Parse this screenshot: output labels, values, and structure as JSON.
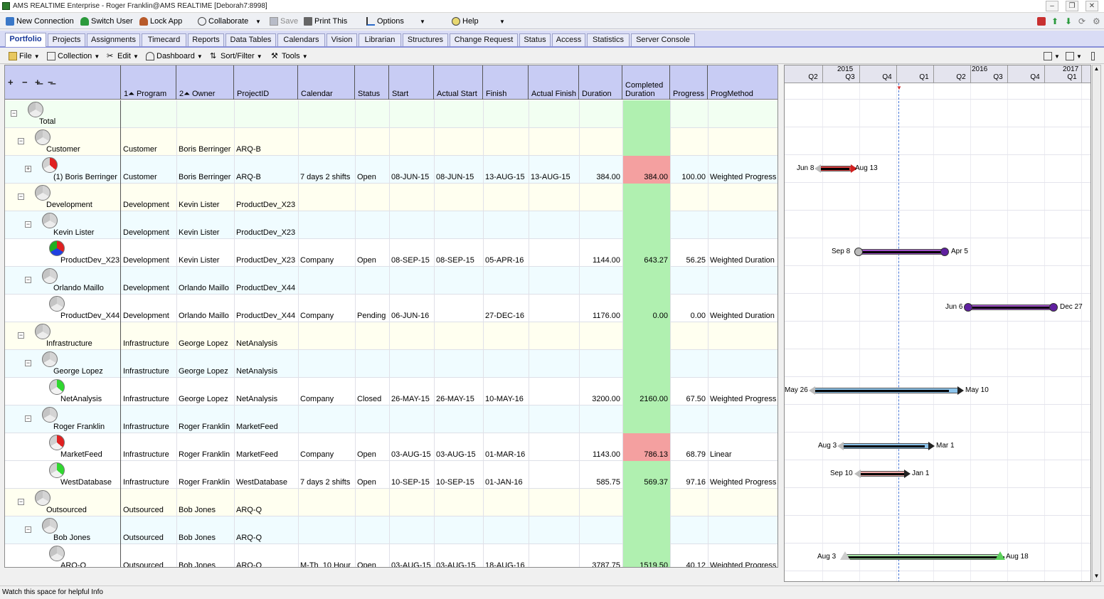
{
  "window": {
    "title": "AMS REALTIME Enterprise - Roger Franklin@AMS REALTIME [Deborah7:8998]"
  },
  "toolbar": {
    "new_connection": "New Connection",
    "switch_user": "Switch User",
    "lock_app": "Lock App",
    "collaborate": "Collaborate",
    "save": "Save",
    "print_this": "Print This",
    "options": "Options",
    "help": "Help"
  },
  "tabs": [
    "Portfolio",
    "Projects",
    "Assignments",
    "Timecard",
    "Reports",
    "Data Tables",
    "Calendars",
    "Vision",
    "Librarian",
    "Structures",
    "Change Request",
    "Status",
    "Access",
    "Statistics",
    "Server Console"
  ],
  "menu": {
    "file": "File",
    "collection": "Collection",
    "edit": "Edit",
    "dashboard": "Dashboard",
    "sort_filter": "Sort/Filter",
    "tools": "Tools"
  },
  "columns": {
    "program": "1⏶ Program",
    "owner": "2⏶ Owner",
    "projectid": "ProjectID",
    "calendar": "Calendar",
    "status": "Status",
    "start": "Start",
    "actual_start": "Actual Start",
    "finish": "Finish",
    "actual_finish": "Actual Finish",
    "duration": "Duration",
    "completed_duration": "Completed Duration",
    "progress": "Progress",
    "progmethod": "ProgMethod"
  },
  "rows": [
    {
      "name": "Total",
      "level": 0,
      "pie": "grey",
      "bg": "#f2fff2",
      "program": "",
      "owner": "",
      "projectid": "",
      "calendar": "",
      "status": "",
      "start": "",
      "actual_start": "",
      "finish": "",
      "actual_finish": "",
      "duration": "",
      "completed": "",
      "progress": "",
      "method": ""
    },
    {
      "name": "Customer",
      "level": 1,
      "pie": "grey",
      "bg": "#fffff0",
      "program": "Customer",
      "owner": "Boris Berringer",
      "projectid": "ARQ-B",
      "calendar": "",
      "status": "",
      "start": "",
      "actual_start": "",
      "finish": "",
      "actual_finish": "",
      "duration": "",
      "completed": "",
      "progress": "",
      "method": ""
    },
    {
      "name": "(1) Boris Berringer",
      "level": 2,
      "pie": "red",
      "bg": "#f0fcff",
      "program": "Customer",
      "owner": "Boris Berringer",
      "projectid": "ARQ-B",
      "calendar": "7 days 2 shifts",
      "status": "Open",
      "start": "08-JUN-15",
      "actual_start": "08-JUN-15",
      "finish": "13-AUG-15",
      "actual_finish": "13-AUG-15",
      "duration": "384.00",
      "completed": "384.00",
      "completed_red": true,
      "progress": "100.00",
      "method": "Weighted Progress"
    },
    {
      "name": "Development",
      "level": 1,
      "pie": "grey",
      "bg": "#fffff0",
      "program": "Development",
      "owner": "Kevin Lister",
      "projectid": "ProductDev_X23",
      "calendar": "",
      "status": "",
      "start": "",
      "actual_start": "",
      "finish": "",
      "actual_finish": "",
      "duration": "",
      "completed": "",
      "progress": "",
      "method": ""
    },
    {
      "name": "Kevin Lister",
      "level": 2,
      "pie": "grey",
      "bg": "#f0fcff",
      "program": "Development",
      "owner": "Kevin Lister",
      "projectid": "ProductDev_X23",
      "calendar": "",
      "status": "",
      "start": "",
      "actual_start": "",
      "finish": "",
      "actual_finish": "",
      "duration": "",
      "completed": "",
      "progress": "",
      "method": ""
    },
    {
      "name": "ProductDev_X23",
      "level": 3,
      "pie": "rgb",
      "bg": "#ffffff",
      "program": "Development",
      "owner": "Kevin Lister",
      "projectid": "ProductDev_X23",
      "calendar": "Company",
      "status": "Open",
      "start": "08-SEP-15",
      "actual_start": "08-SEP-15",
      "finish": "05-APR-16",
      "actual_finish": "",
      "duration": "1144.00",
      "completed": "643.27",
      "progress": "56.25",
      "method": "Weighted Duration"
    },
    {
      "name": "Orlando Maillo",
      "level": 2,
      "pie": "grey",
      "bg": "#f0fcff",
      "program": "Development",
      "owner": "Orlando Maillo",
      "projectid": "ProductDev_X44",
      "calendar": "",
      "status": "",
      "start": "",
      "actual_start": "",
      "finish": "",
      "actual_finish": "",
      "duration": "",
      "completed": "",
      "progress": "",
      "method": ""
    },
    {
      "name": "ProductDev_X44",
      "level": 3,
      "pie": "grey",
      "bg": "#ffffff",
      "program": "Development",
      "owner": "Orlando Maillo",
      "projectid": "ProductDev_X44",
      "calendar": "Company",
      "status": "Pending",
      "start": "06-JUN-16",
      "actual_start": "",
      "finish": "27-DEC-16",
      "actual_finish": "",
      "duration": "1176.00",
      "completed": "0.00",
      "progress": "0.00",
      "method": "Weighted Duration"
    },
    {
      "name": "Infrastructure",
      "level": 1,
      "pie": "grey",
      "bg": "#fffff0",
      "program": "Infrastructure",
      "owner": "George Lopez",
      "projectid": "NetAnalysis",
      "calendar": "",
      "status": "",
      "start": "",
      "actual_start": "",
      "finish": "",
      "actual_finish": "",
      "duration": "",
      "completed": "",
      "progress": "",
      "method": ""
    },
    {
      "name": "George Lopez",
      "level": 2,
      "pie": "grey",
      "bg": "#f0fcff",
      "program": "Infrastructure",
      "owner": "George Lopez",
      "projectid": "NetAnalysis",
      "calendar": "",
      "status": "",
      "start": "",
      "actual_start": "",
      "finish": "",
      "actual_finish": "",
      "duration": "",
      "completed": "",
      "progress": "",
      "method": ""
    },
    {
      "name": "NetAnalysis",
      "level": 3,
      "pie": "green",
      "bg": "#ffffff",
      "program": "Infrastructure",
      "owner": "George Lopez",
      "projectid": "NetAnalysis",
      "calendar": "Company",
      "status": "Closed",
      "start": "26-MAY-15",
      "actual_start": "26-MAY-15",
      "finish": "10-MAY-16",
      "actual_finish": "",
      "duration": "3200.00",
      "completed": "2160.00",
      "progress": "67.50",
      "method": "Weighted Progress"
    },
    {
      "name": "Roger Franklin",
      "level": 2,
      "pie": "grey",
      "bg": "#f0fcff",
      "program": "Infrastructure",
      "owner": "Roger Franklin",
      "projectid": "MarketFeed",
      "calendar": "",
      "status": "",
      "start": "",
      "actual_start": "",
      "finish": "",
      "actual_finish": "",
      "duration": "",
      "completed": "",
      "progress": "",
      "method": ""
    },
    {
      "name": "MarketFeed",
      "level": 3,
      "pie": "red",
      "bg": "#ffffff",
      "program": "Infrastructure",
      "owner": "Roger Franklin",
      "projectid": "MarketFeed",
      "calendar": "Company",
      "status": "Open",
      "start": "03-AUG-15",
      "actual_start": "03-AUG-15",
      "finish": "01-MAR-16",
      "actual_finish": "",
      "duration": "1143.00",
      "completed": "786.13",
      "completed_red": true,
      "progress": "68.79",
      "method": "Linear"
    },
    {
      "name": "WestDatabase",
      "level": 3,
      "pie": "green",
      "bg": "#ffffff",
      "program": "Infrastructure",
      "owner": "Roger Franklin",
      "projectid": "WestDatabase",
      "calendar": "7 days 2 shifts",
      "status": "Open",
      "start": "10-SEP-15",
      "actual_start": "10-SEP-15",
      "finish": "01-JAN-16",
      "actual_finish": "",
      "duration": "585.75",
      "completed": "569.37",
      "progress": "97.16",
      "method": "Weighted Progress"
    },
    {
      "name": "Outsourced",
      "level": 1,
      "pie": "grey",
      "bg": "#fffff0",
      "program": "Outsourced",
      "owner": "Bob Jones",
      "projectid": "ARQ-Q",
      "calendar": "",
      "status": "",
      "start": "",
      "actual_start": "",
      "finish": "",
      "actual_finish": "",
      "duration": "",
      "completed": "",
      "progress": "",
      "method": ""
    },
    {
      "name": "Bob Jones",
      "level": 2,
      "pie": "grey",
      "bg": "#f0fcff",
      "program": "Outsourced",
      "owner": "Bob Jones",
      "projectid": "ARQ-Q",
      "calendar": "",
      "status": "",
      "start": "",
      "actual_start": "",
      "finish": "",
      "actual_finish": "",
      "duration": "",
      "completed": "",
      "progress": "",
      "method": ""
    },
    {
      "name": "ARQ-Q",
      "level": 3,
      "pie": "grey",
      "bg": "#ffffff",
      "program": "Outsourced",
      "owner": "Bob Jones",
      "projectid": "ARQ-Q",
      "calendar": "M-Th_10 Hour",
      "status": "Open",
      "start": "03-AUG-15",
      "actual_start": "03-AUG-15",
      "finish": "18-AUG-16",
      "actual_finish": "",
      "duration": "3787.75",
      "completed": "1519.50",
      "progress": "40.12",
      "method": "Weighted Progress"
    }
  ],
  "gantt": {
    "years": [
      "2015",
      "2016",
      "2017"
    ],
    "quarters": [
      "Q2",
      "Q3",
      "Q4",
      "Q1",
      "Q2",
      "Q3",
      "Q4",
      "Q1"
    ],
    "bars": [
      {
        "row": 2,
        "start_label": "Jun 8",
        "end_label": "Aug 13",
        "color": "#d84040"
      },
      {
        "row": 5,
        "start_label": "Sep 8",
        "end_label": "Apr 5",
        "color": "#a050c8"
      },
      {
        "row": 7,
        "start_label": "Jun 6",
        "end_label": "Dec 27",
        "color": "#a050c8"
      },
      {
        "row": 10,
        "start_label": "May 26",
        "end_label": "May 10",
        "color": "#8cc4ec"
      },
      {
        "row": 12,
        "start_label": "Aug 3",
        "end_label": "Mar 1",
        "color": "#8cc4ec"
      },
      {
        "row": 13,
        "start_label": "Sep 10",
        "end_label": "Jan 1",
        "color": "#f0a8a8"
      },
      {
        "row": 16,
        "start_label": "Aug 3",
        "end_label": "Aug 18",
        "color": "#a8e8a8"
      }
    ]
  },
  "colors": {
    "completed_col": "#b0f0b0",
    "completed_red": "#f4a0a0",
    "header": "#c8ccf4"
  },
  "status_bar": "Watch this space for helpful Info"
}
